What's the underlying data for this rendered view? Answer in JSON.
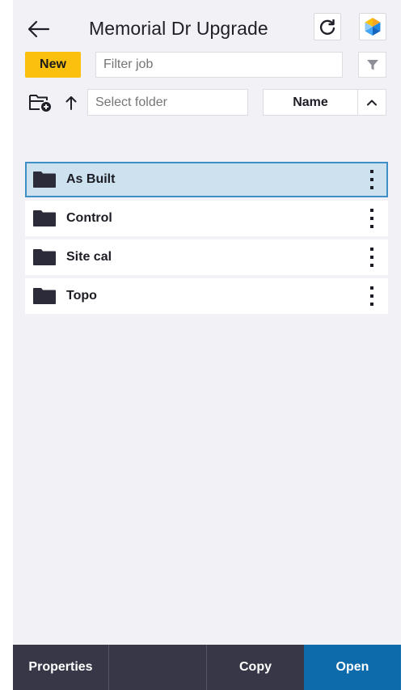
{
  "header": {
    "title": "Memorial Dr Upgrade",
    "back_icon": "arrow-left-icon",
    "refresh_icon": "refresh-icon",
    "app_icon": "app-logo-icon"
  },
  "toolbar": {
    "new_label": "New",
    "filter_placeholder": "Filter job",
    "filter_icon": "filter-icon"
  },
  "folder_bar": {
    "add_folder_icon": "folder-add-icon",
    "up_icon": "arrow-up-icon",
    "folder_placeholder": "Select folder",
    "sort_label": "Name",
    "sort_direction_icon": "chevron-up-icon"
  },
  "folders": [
    {
      "name": "As Built",
      "selected": true
    },
    {
      "name": "Control",
      "selected": false
    },
    {
      "name": "Site cal",
      "selected": false
    },
    {
      "name": "Topo",
      "selected": false
    }
  ],
  "bottom_bar": {
    "properties_label": "Properties",
    "blank_label": "",
    "copy_label": "Copy",
    "open_label": "Open"
  },
  "colors": {
    "accent_yellow": "#fbbf0e",
    "primary_blue": "#0d6aab",
    "bar_dark": "#373747",
    "selection_fill": "#cde1ef",
    "selection_border": "#3f8fc7"
  }
}
